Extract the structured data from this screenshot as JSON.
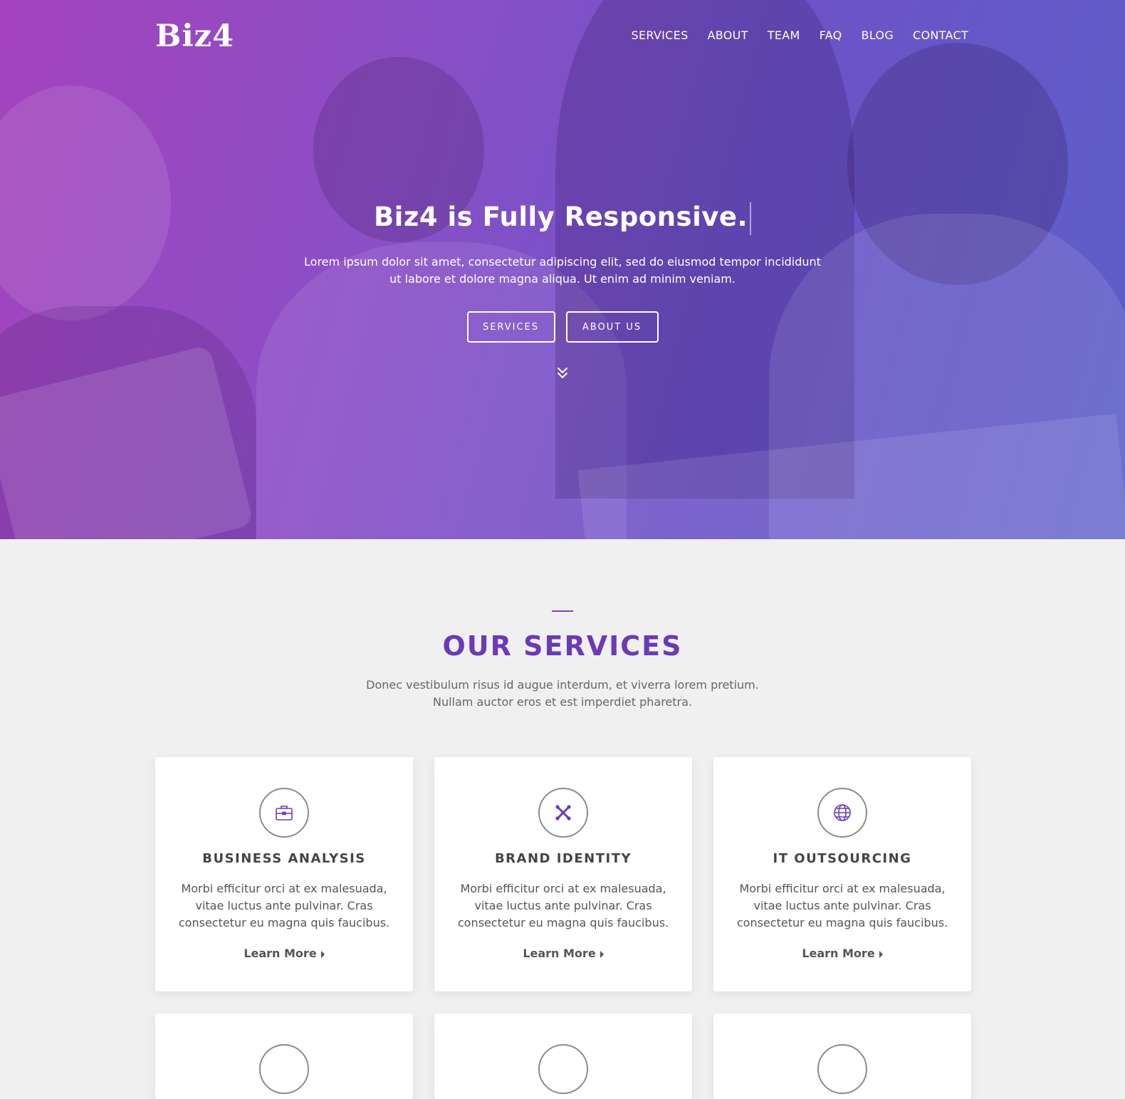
{
  "brand": {
    "logo": "Biz4"
  },
  "nav": {
    "items": [
      {
        "label": "SERVICES"
      },
      {
        "label": "ABOUT"
      },
      {
        "label": "TEAM"
      },
      {
        "label": "FAQ"
      },
      {
        "label": "BLOG"
      },
      {
        "label": "CONTACT"
      }
    ]
  },
  "hero": {
    "title": "Biz4 is Fully Responsive.",
    "text": "Lorem ipsum dolor sit amet, consectetur adipiscing elit, sed do eiusmod tempor incididunt ut labore et dolore magna aliqua. Ut enim ad minim veniam.",
    "buttons": {
      "services": "SERVICES",
      "about": "ABOUT US"
    },
    "scroll_icon": "chevron-double-down-icon",
    "overlay_colors": [
      "#a443bd",
      "#6c53c8",
      "#5c5fc8"
    ]
  },
  "services": {
    "title": "OUR SERVICES",
    "subtitle": "Donec vestibulum risus id augue interdum, et viverra lorem pretium. Nullam auctor eros et est imperdiet pharetra.",
    "accent_color": "#6a3ab8",
    "cards": [
      {
        "icon": "briefcase-icon",
        "title": "BUSINESS ANALYSIS",
        "text": "Morbi efficitur orci at ex malesuada, vitae luctus ante pulvinar. Cras consectetur eu magna quis faucibus.",
        "link": "Learn More"
      },
      {
        "icon": "joomla-icon",
        "title": "BRAND IDENTITY",
        "text": "Morbi efficitur orci at ex malesuada, vitae luctus ante pulvinar. Cras consectetur eu magna quis faucibus.",
        "link": "Learn More"
      },
      {
        "icon": "globe-icon",
        "title": "IT OUTSOURCING",
        "text": "Morbi efficitur orci at ex malesuada, vitae luctus ante pulvinar. Cras consectetur eu magna quis faucibus.",
        "link": "Learn More"
      }
    ]
  }
}
